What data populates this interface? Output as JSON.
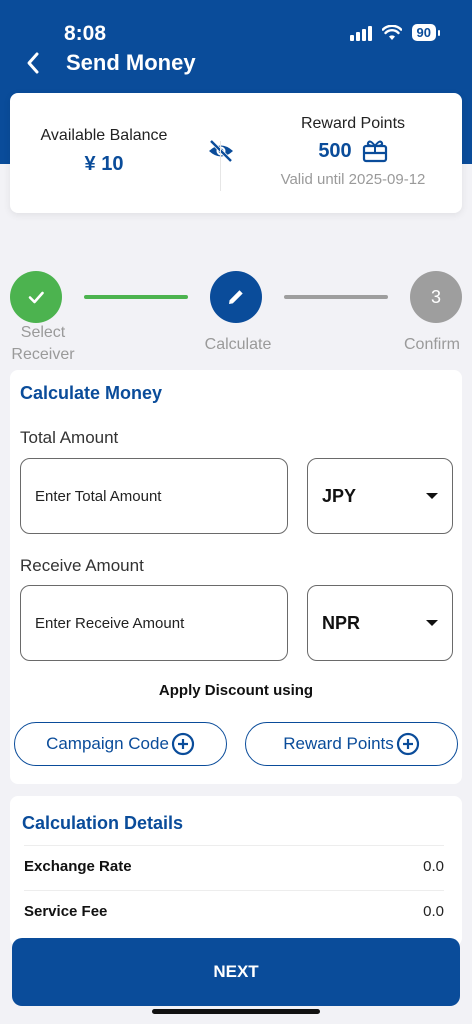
{
  "status_bar": {
    "time": "8:08",
    "battery": "90"
  },
  "header": {
    "title": "Send Money"
  },
  "balance": {
    "label": "Available Balance",
    "value": "¥ 10",
    "reward_label": "Reward Points",
    "reward_value": "500",
    "reward_valid": "Valid until 2025-09-12"
  },
  "stepper": {
    "step3_number": "3",
    "steps": [
      {
        "label": "Select Receiver"
      },
      {
        "label": "Calculate"
      },
      {
        "label": "Confirm"
      }
    ]
  },
  "calculate": {
    "title": "Calculate Money",
    "total_label": "Total Amount",
    "total_placeholder": "Enter Total Amount",
    "total_currency": "JPY",
    "receive_label": "Receive Amount",
    "receive_placeholder": "Enter Receive Amount",
    "receive_currency": "NPR",
    "apply_discount": "Apply Discount using",
    "campaign_button": "Campaign Code",
    "reward_button": "Reward Points"
  },
  "details": {
    "title": "Calculation Details",
    "rows": [
      {
        "label": "Exchange Rate",
        "value": "0.0"
      },
      {
        "label": "Service Fee",
        "value": "0.0"
      }
    ]
  },
  "footer": {
    "next_label": "NEXT"
  },
  "colors": {
    "primary": "#0a4c9a",
    "success": "#4cb34f",
    "inactive": "#9e9e9e"
  }
}
